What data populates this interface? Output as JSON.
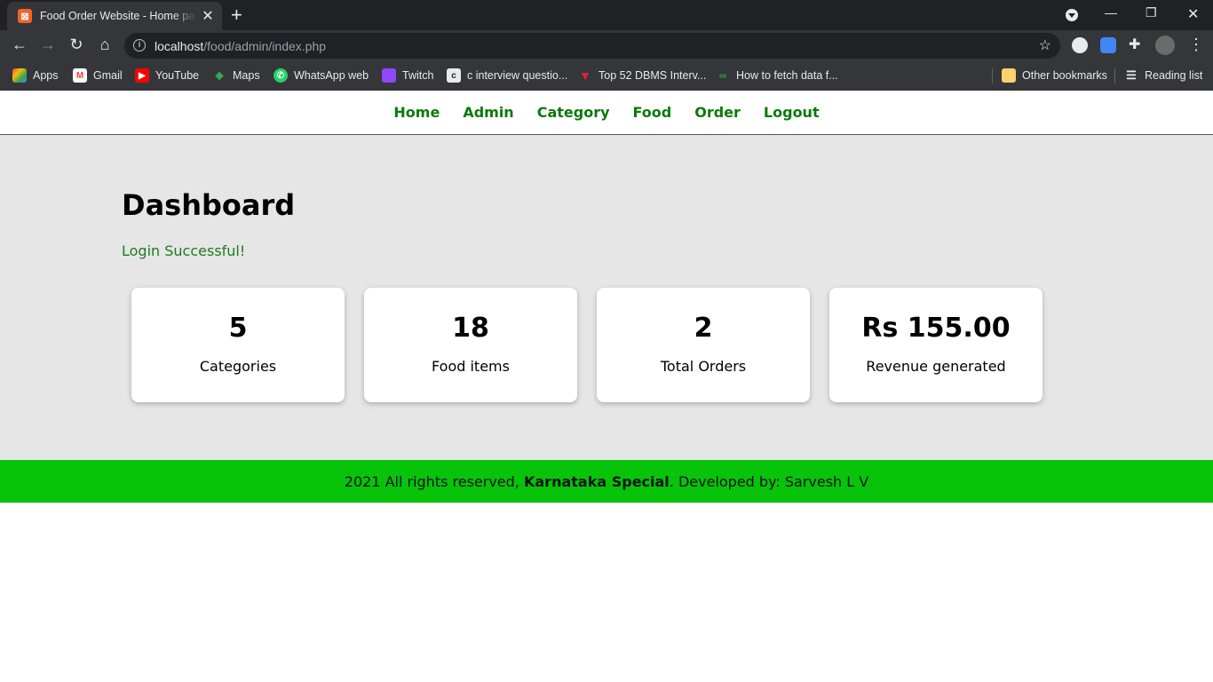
{
  "browser": {
    "tab_title": "Food Order Website - Home page",
    "tab_favicon_glyph": "⊠",
    "url_host": "localhost",
    "url_path": "/food/admin/index.php",
    "bookmarks": [
      {
        "label": "Apps",
        "icon": "apps-grid-icon",
        "color": "#4285f4"
      },
      {
        "label": "Gmail",
        "icon": "gmail-icon",
        "color": "#ea4335"
      },
      {
        "label": "YouTube",
        "icon": "youtube-icon",
        "color": "#ff0000"
      },
      {
        "label": "Maps",
        "icon": "maps-pin-icon",
        "color": "#34a853"
      },
      {
        "label": "WhatsApp web",
        "icon": "whatsapp-icon",
        "color": "#25d366"
      },
      {
        "label": "Twitch",
        "icon": "twitch-icon",
        "color": "#9146ff"
      },
      {
        "label": "c interview questio...",
        "icon": "page-icon",
        "color": "#e8eaed"
      },
      {
        "label": "Top 52 DBMS Interv...",
        "icon": "triangle-icon",
        "color": "#e0242f"
      },
      {
        "label": "How to fetch data f...",
        "icon": "link-icon",
        "color": "#2f9e44"
      }
    ],
    "other_bookmarks": "Other bookmarks",
    "reading_list": "Reading list"
  },
  "nav": {
    "items": [
      "Home",
      "Admin",
      "Category",
      "Food",
      "Order",
      "Logout"
    ]
  },
  "dashboard": {
    "title": "Dashboard",
    "login_message": "Login Successful!",
    "cards": [
      {
        "value": "5",
        "label": "Categories"
      },
      {
        "value": "18",
        "label": "Food items"
      },
      {
        "value": "2",
        "label": "Total Orders"
      },
      {
        "value": "Rs 155.00",
        "label": "Revenue generated"
      }
    ]
  },
  "footer": {
    "prefix": "2021 All rights reserved, ",
    "brand": "Karnataka Special",
    "suffix": ". Developed by: Sarvesh L V"
  },
  "colors": {
    "nav_link": "#0a7a0a",
    "success_text": "#1e7b1e",
    "footer_bg": "#07c30a",
    "main_bg": "#e6e6e6"
  }
}
